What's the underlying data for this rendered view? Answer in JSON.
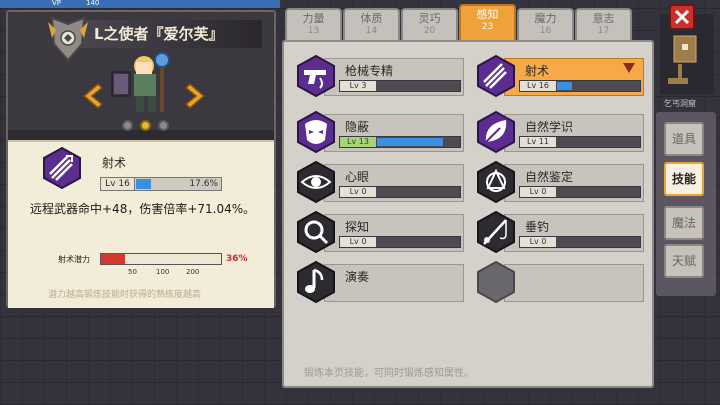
{
  "character": {
    "name": "L之使者『爱尔芙』",
    "page_dots": [
      false,
      true,
      false
    ]
  },
  "top_left_badges": [
    "VP",
    "140"
  ],
  "selected_skill": {
    "name": "射术",
    "level": "Lv 16",
    "progress_pct": 17.6,
    "progress_text": "17.6%",
    "description": "远程武器命中+48，伤害倍率+71.04%。",
    "potential_label": "射术潜力",
    "potential_pct": 36,
    "potential_text": "36%",
    "potential_ticks": [
      "50",
      "100",
      "200"
    ],
    "footer": "潜力越高锻炼技能时获得的熟练度越高"
  },
  "attribute_tabs": [
    {
      "label": "力量",
      "value": "13",
      "active": false
    },
    {
      "label": "体质",
      "value": "14",
      "active": false
    },
    {
      "label": "灵巧",
      "value": "20",
      "active": false
    },
    {
      "label": "感知",
      "value": "23",
      "active": true
    },
    {
      "label": "魔力",
      "value": "16",
      "active": false
    },
    {
      "label": "意志",
      "value": "17",
      "active": false
    }
  ],
  "skills": [
    {
      "name": "枪械专精",
      "level": "Lv 3",
      "fill_pct": 0,
      "icon": "gun-icon",
      "green": false
    },
    {
      "name": "射术",
      "level": "Lv 16",
      "fill_pct": 17.6,
      "icon": "arrows-icon",
      "green": false,
      "highlight": true
    },
    {
      "name": "隐蔽",
      "level": "Lv 13",
      "fill_pct": 78,
      "icon": "mask-icon",
      "green": true
    },
    {
      "name": "自然学识",
      "level": "Lv 11",
      "fill_pct": 0,
      "icon": "leaf-icon",
      "green": false
    },
    {
      "name": "心眼",
      "level": "Lv 0",
      "fill_pct": 0,
      "icon": "eye-icon",
      "green": false
    },
    {
      "name": "自然鉴定",
      "level": "Lv 0",
      "fill_pct": 0,
      "icon": "triquetra-icon",
      "green": false
    },
    {
      "name": "探知",
      "level": "Lv 0",
      "fill_pct": 0,
      "icon": "magnifier-icon",
      "green": false
    },
    {
      "name": "垂钓",
      "level": "Lv 0",
      "fill_pct": 0,
      "icon": "fishing-icon",
      "green": false
    },
    {
      "name": "演奏",
      "level": "Lv 0",
      "fill_pct": 0,
      "icon": "music-note-icon",
      "green": false
    }
  ],
  "main_footer": "锻炼本页技能，可同时锻炼感知属性。",
  "location": "乞丐洞窟",
  "side_tabs": [
    {
      "label": "道具",
      "active": false
    },
    {
      "label": "技能",
      "active": true
    },
    {
      "label": "魔法",
      "active": false
    },
    {
      "label": "天赋",
      "active": false
    }
  ],
  "colors": {
    "accent_orange": "#f0a13a",
    "skill_purple": "#5b2d8f",
    "progress_blue": "#3b8fe0",
    "potential_red": "#d23a2e"
  }
}
